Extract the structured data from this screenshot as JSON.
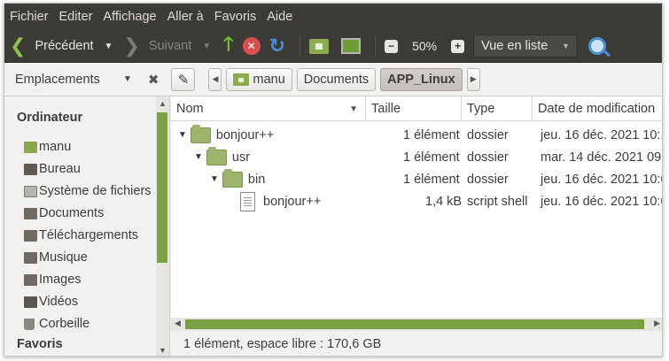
{
  "menu": [
    "Fichier",
    "Editer",
    "Affichage",
    "Aller à",
    "Favoris",
    "Aide"
  ],
  "toolbar": {
    "back_label": "Précédent",
    "forward_label": "Suivant",
    "zoom_value": "50%",
    "zoom_out_icon": "zoom-out-icon",
    "zoom_in_icon": "zoom-in-icon",
    "view_mode": "Vue en liste"
  },
  "locationbar": {
    "places_label": "Emplacements",
    "breadcrumbs": [
      "manu",
      "Documents",
      "APP_Linux"
    ],
    "active_crumb": "APP_Linux"
  },
  "sidebar": {
    "heading_computer": "Ordinateur",
    "items": [
      {
        "label": "manu",
        "icon": "home-folder-icon"
      },
      {
        "label": "Bureau",
        "icon": "desktop-icon"
      },
      {
        "label": "Système de fichiers",
        "icon": "drive-icon"
      },
      {
        "label": "Documents",
        "icon": "documents-icon"
      },
      {
        "label": "Téléchargements",
        "icon": "downloads-icon"
      },
      {
        "label": "Musique",
        "icon": "music-icon"
      },
      {
        "label": "Images",
        "icon": "pictures-icon"
      },
      {
        "label": "Vidéos",
        "icon": "videos-icon"
      },
      {
        "label": "Corbeille",
        "icon": "trash-icon"
      }
    ],
    "heading_favorites": "Favoris"
  },
  "columns": {
    "name": "Nom",
    "size": "Taille",
    "type": "Type",
    "modified": "Date de modification"
  },
  "rows": [
    {
      "name": "bonjour++",
      "size": "1 élément",
      "type": "dossier",
      "modified": "jeu. 16 déc. 2021 10:1",
      "kind": "folder",
      "depth": 0
    },
    {
      "name": "usr",
      "size": "1 élément",
      "type": "dossier",
      "modified": "mar. 14 déc. 2021 09:",
      "kind": "folder",
      "depth": 1
    },
    {
      "name": "bin",
      "size": "1 élément",
      "type": "dossier",
      "modified": "jeu. 16 déc. 2021 10:0",
      "kind": "folder",
      "depth": 2
    },
    {
      "name": "bonjour++",
      "size": "1,4 kB",
      "type": "script shell",
      "modified": "jeu. 16 déc. 2021 10:0",
      "kind": "file",
      "depth": 3
    }
  ],
  "status": "1 élément, espace libre : 170,6 GB",
  "colors": {
    "menubar_bg": "#3c3b37",
    "accent_green": "#7aa242",
    "folder_green": "#9db56a"
  }
}
